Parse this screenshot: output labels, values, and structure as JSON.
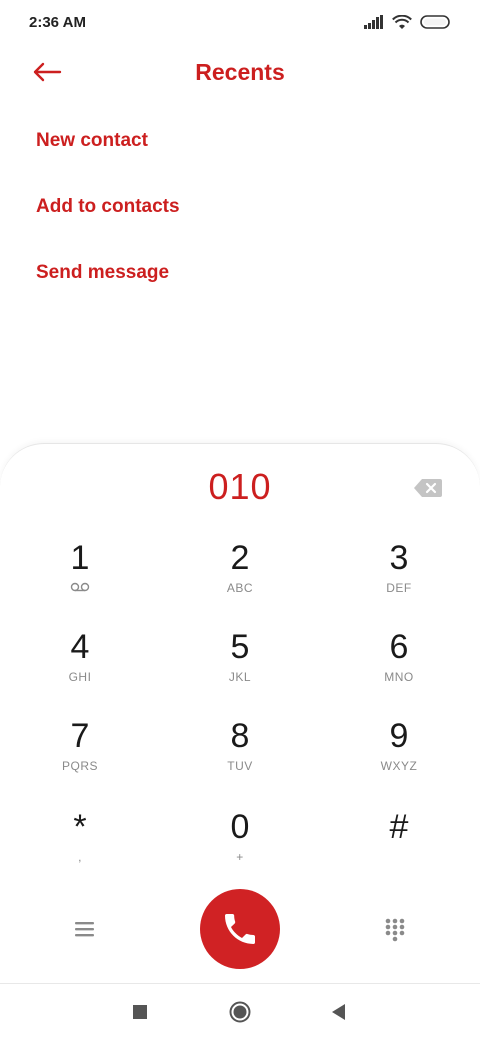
{
  "status_bar": {
    "time": "2:36 AM"
  },
  "header": {
    "title": "Recents"
  },
  "actions": [
    "New contact",
    "Add to contacts",
    "Send message"
  ],
  "dialer": {
    "number": "010",
    "keys": [
      {
        "digit": "1",
        "sub": ""
      },
      {
        "digit": "2",
        "sub": "ABC"
      },
      {
        "digit": "3",
        "sub": "DEF"
      },
      {
        "digit": "4",
        "sub": "GHI"
      },
      {
        "digit": "5",
        "sub": "JKL"
      },
      {
        "digit": "6",
        "sub": "MNO"
      },
      {
        "digit": "7",
        "sub": "PQRS"
      },
      {
        "digit": "8",
        "sub": "TUV"
      },
      {
        "digit": "9",
        "sub": "WXYZ"
      },
      {
        "digit": "*",
        "sub": ","
      },
      {
        "digit": "0",
        "sub": "+"
      },
      {
        "digit": "#",
        "sub": ""
      }
    ]
  },
  "colors": {
    "accent": "#cc1f1f",
    "call": "#d02224"
  }
}
